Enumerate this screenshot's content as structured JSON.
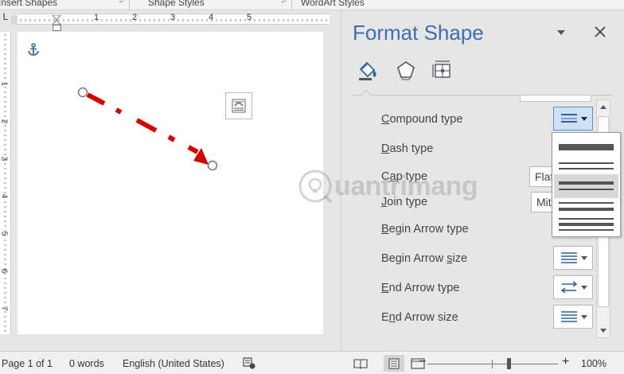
{
  "ribbon_groups": [
    {
      "label": "Insert Shapes"
    },
    {
      "label": "Shape Styles"
    },
    {
      "label": "WordArt Styles"
    }
  ],
  "ruler": {
    "corner_glyph": "L",
    "h_numbers": [
      "1",
      "2",
      "3",
      "4",
      "5"
    ],
    "v_numbers": [
      "1",
      "2",
      "3",
      "4",
      "5",
      "6",
      "7"
    ]
  },
  "document": {
    "arrow_color": "#d40000"
  },
  "pane": {
    "title": "Format Shape",
    "accent": "#3b6fb3",
    "tabs": [
      {
        "name": "fill-line",
        "icon": "paint-bucket-icon",
        "selected": true
      },
      {
        "name": "effects",
        "icon": "pentagon-icon",
        "selected": false
      },
      {
        "name": "size-properties",
        "icon": "size-layout-icon",
        "selected": false
      }
    ],
    "properties": [
      {
        "pre": "",
        "key": "C",
        "post": "ompound type"
      },
      {
        "pre": "",
        "key": "D",
        "post": "ash type"
      },
      {
        "pre": "C",
        "key": "a",
        "post": "p type"
      },
      {
        "pre": "",
        "key": "J",
        "post": "oin type"
      },
      {
        "pre": "",
        "key": "B",
        "post": "egin Arrow type"
      },
      {
        "pre": "Begin Arrow ",
        "key": "s",
        "post": "ize"
      },
      {
        "pre": "",
        "key": "E",
        "post": "nd Arrow type"
      },
      {
        "pre": "E",
        "key": "n",
        "post": "d Arrow size"
      }
    ],
    "cap_value": "Flat",
    "join_value": "Miter"
  },
  "compound_menu": {
    "options": [
      {
        "name": "single"
      },
      {
        "name": "double"
      },
      {
        "name": "thick-thin"
      },
      {
        "name": "thin-thick"
      },
      {
        "name": "triple"
      }
    ],
    "hovered_index": 2
  },
  "status": {
    "page": "Page 1 of 1",
    "words": "0 words",
    "language": "English (United States)",
    "zoom_minus": "−",
    "zoom_plus": "+",
    "zoom": "100%",
    "zoom_fraction": 0.62
  },
  "watermark": {
    "text": "uantrimang"
  }
}
